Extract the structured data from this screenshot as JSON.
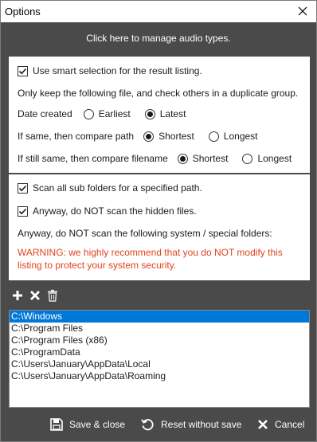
{
  "window": {
    "title": "Options",
    "close_icon": "close-icon"
  },
  "manage_link": "Click here to manage audio types.",
  "smart_selection": {
    "checkbox_label": "Use smart selection for the result listing.",
    "checked": true,
    "hint": "Only keep the following file, and check others in a duplicate group.",
    "date_label": "Date created",
    "date_options": [
      "Earliest",
      "Latest"
    ],
    "date_selected": "Latest",
    "path_label": "If same, then compare path",
    "path_options": [
      "Shortest",
      "Longest"
    ],
    "path_selected": "Shortest",
    "filename_label": "If still same, then compare filename",
    "filename_options": [
      "Shortest",
      "Longest"
    ],
    "filename_selected": "Shortest"
  },
  "scan": {
    "subfolders_label": "Scan all sub folders for a specified path.",
    "subfolders_checked": true,
    "hidden_label": "Anyway, do NOT scan the hidden files.",
    "hidden_checked": true,
    "system_label": "Anyway, do NOT scan the following system / special folders:",
    "warning": "WARNING: we highly recommend that you do NOT modify this listing to protect your system security.",
    "warning_color": "#e0441d"
  },
  "toolbar": {
    "icons": [
      "add-icon",
      "remove-icon",
      "trash-icon"
    ]
  },
  "folders": [
    "C:\\Windows",
    "C:\\Program Files",
    "C:\\Program Files (x86)",
    "C:\\ProgramData",
    "C:\\Users\\January\\AppData\\Local",
    "C:\\Users\\January\\AppData\\Roaming"
  ],
  "selected_folder_index": 0,
  "footer": {
    "save_label": "Save & close",
    "reset_label": "Reset without save",
    "cancel_label": "Cancel"
  },
  "colors": {
    "background": "#4a4a4a",
    "selection": "#0078d7"
  }
}
